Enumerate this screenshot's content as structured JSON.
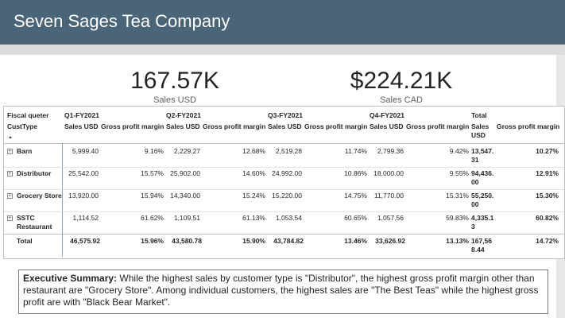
{
  "header": {
    "title": "Seven Sages Tea Company"
  },
  "kpis": [
    {
      "value": "167.57K",
      "label": "Sales USD"
    },
    {
      "value": "$224.21K",
      "label": "Sales CAD"
    }
  ],
  "matrix": {
    "corner_top": "Fiscal queter",
    "corner_bottom": "CustType",
    "quarters": [
      "Q1-FY2021",
      "Q2-FY2021",
      "Q3-FY2021",
      "Q4-FY2021",
      "Total"
    ],
    "measure_sales": "Sales USD",
    "measure_gpm": "Gross profit margin",
    "rows": [
      {
        "label": "Barn",
        "cells": [
          "5,999.40",
          "9.16%",
          "2,229.27",
          "12.68%",
          "2,519.28",
          "11.74%",
          "2,799.36",
          "9.42%"
        ],
        "total_sales": "13,547.31",
        "total_gpm": "10.27%"
      },
      {
        "label": "Distributor",
        "cells": [
          "25,542.00",
          "15.57%",
          "25,902.00",
          "14.60%",
          "24,992.00",
          "10.86%",
          "18,000.00",
          "9.55%"
        ],
        "total_sales": "94,436.00",
        "total_gpm": "12.91%"
      },
      {
        "label": "Grocery Store",
        "cells": [
          "13,920.00",
          "15.94%",
          "14,340.00",
          "15.24%",
          "15,220.00",
          "14.75%",
          "11,770.00",
          "15.31%"
        ],
        "total_sales": "55,250.00",
        "total_gpm": "15.30%"
      },
      {
        "label": "SSTC Restaurant",
        "cells": [
          "1,114.52",
          "61.62%",
          "1,109.51",
          "61.13%",
          "1,053.54",
          "60.65%",
          "1,057.56",
          "59.83%"
        ],
        "total_sales": "4,335.13",
        "total_gpm": "60.82%"
      }
    ],
    "total_row": {
      "label": "Total",
      "cells": [
        "46,575.92",
        "15.96%",
        "43,580.78",
        "15.90%",
        "43,784.82",
        "13.46%",
        "33,626.92",
        "13.13%"
      ],
      "total_sales": "167,568.44",
      "total_gpm": "14.72%"
    }
  },
  "summary": {
    "bold": "Executive Summary:",
    "text": " While the highest sales by customer type is \"Distributor\", the highest gross profit margin other than restaurant are \"Grocery Store\". Among individual customers, the highest sales are \"The Best Teas\" while the highest gross profit are with \"Black Bear Market\"."
  },
  "colors": {
    "header_bg": "#4a6478",
    "accent_line": "#8fa7b8"
  }
}
